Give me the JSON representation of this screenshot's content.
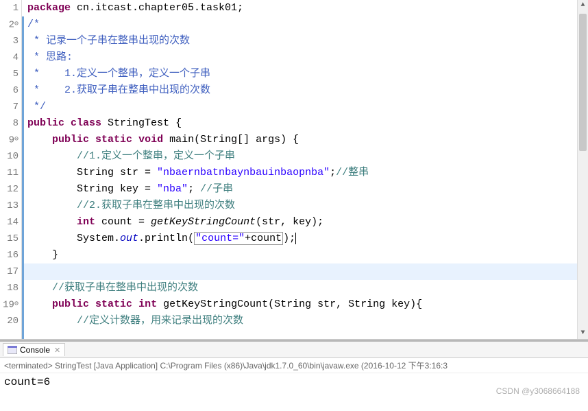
{
  "lines": [
    {
      "num": "1",
      "fold": ""
    },
    {
      "num": "2",
      "fold": "⊖"
    },
    {
      "num": "3",
      "fold": ""
    },
    {
      "num": "4",
      "fold": ""
    },
    {
      "num": "5",
      "fold": ""
    },
    {
      "num": "6",
      "fold": ""
    },
    {
      "num": "7",
      "fold": ""
    },
    {
      "num": "8",
      "fold": ""
    },
    {
      "num": "9",
      "fold": "⊖"
    },
    {
      "num": "10",
      "fold": ""
    },
    {
      "num": "11",
      "fold": ""
    },
    {
      "num": "12",
      "fold": ""
    },
    {
      "num": "13",
      "fold": ""
    },
    {
      "num": "14",
      "fold": ""
    },
    {
      "num": "15",
      "fold": ""
    },
    {
      "num": "16",
      "fold": ""
    },
    {
      "num": "17",
      "fold": ""
    },
    {
      "num": "18",
      "fold": ""
    },
    {
      "num": "19",
      "fold": "⊖"
    },
    {
      "num": "20",
      "fold": ""
    }
  ],
  "code": {
    "l1": {
      "kw1": "package",
      "pkg": " cn.itcast.chapter05.task01;"
    },
    "l2": {
      "c": "/*"
    },
    "l3": {
      "c": " * 记录一个子串在整串出现的次数"
    },
    "l4": {
      "c": " * 思路:"
    },
    "l5": {
      "c": " *    1.定义一个整串，定义一个子串"
    },
    "l6": {
      "c": " *    2.获取子串在整串中出现的次数"
    },
    "l7": {
      "c": " */"
    },
    "l8": {
      "kw1": "public",
      "kw2": "class",
      "name": " StringTest {"
    },
    "l9": {
      "kw1": "public",
      "kw2": "static",
      "kw3": "void",
      "name": " main(String[] args) {"
    },
    "l10": {
      "c": "//1.定义一个整串，定义一个子串"
    },
    "l11": {
      "t1": "String str = ",
      "s": "\"nbaernbatnbaynbauinbaopnba\"",
      "t2": ";",
      "c": "//整串"
    },
    "l12": {
      "t1": "String key = ",
      "s": "\"nba\"",
      "t2": "; ",
      "c": "//子串"
    },
    "l13": {
      "c": "//2.获取子串在整串中出现的次数"
    },
    "l14": {
      "kw1": "int",
      "t1": " count = ",
      "m": "getKeyStringCount",
      "t2": "(str, key);"
    },
    "l15": {
      "t1": "System.",
      "out": "out",
      "t2": ".println(",
      "s": "\"count=\"",
      "t3": "+count",
      "t4": ");"
    },
    "l16": {
      "t": "}"
    },
    "l18": {
      "c": "//获取子串在整串中出现的次数"
    },
    "l19": {
      "kw1": "public",
      "kw2": "static",
      "kw3": "int",
      "name": " getKeyStringCount(String str, String key){"
    },
    "l20": {
      "c": "//定义计数器，用来记录出现的次数"
    }
  },
  "console": {
    "tab_label": "Console",
    "status": "<terminated> StringTest [Java Application] C:\\Program Files (x86)\\Java\\jdk1.7.0_60\\bin\\javaw.exe (2016-10-12 下午3:16:3",
    "output": "count=6"
  },
  "watermark": "CSDN @y3068664188"
}
